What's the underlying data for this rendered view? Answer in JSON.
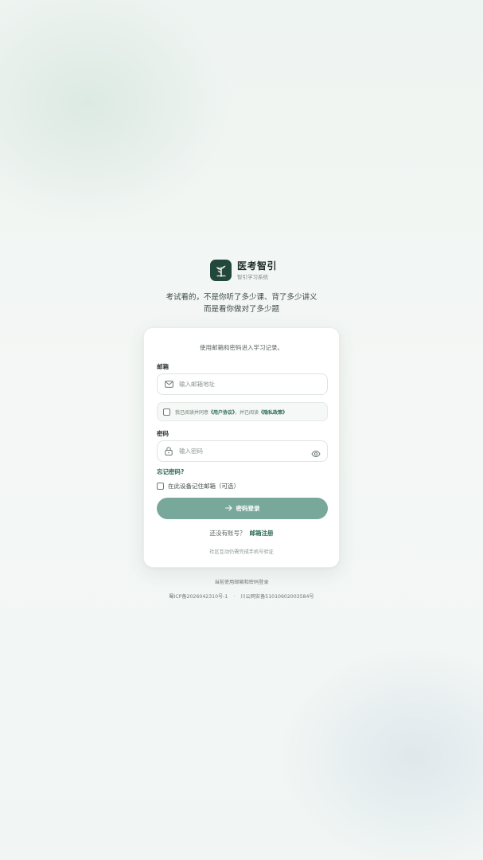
{
  "brand": {
    "name": "医考智引",
    "subtitle": "智引学习系统",
    "logo_icon": "plant-sprout-icon"
  },
  "tagline": {
    "line1": "考试看的，不是你听了多少课、背了多少讲义",
    "line2": "而是看你做对了多少题"
  },
  "card": {
    "intro": "使用邮箱和密码进入学习记录。",
    "email": {
      "label": "邮箱",
      "placeholder": "输入邮箱地址",
      "value": "",
      "icon": "mail-icon"
    },
    "agreement": {
      "checked": false,
      "prefix": "我已阅读并同意",
      "user_agreement": "《用户协议》",
      "middle": "，并已阅读",
      "privacy_policy": "《隐私政策》"
    },
    "password": {
      "label": "密码",
      "placeholder": "输入密码",
      "value": "",
      "icon": "lock-icon",
      "toggle_icon": "eye-icon"
    },
    "forgot_password": "忘记密码?",
    "remember": {
      "checked": false,
      "label": "在此设备记住邮箱（可选）"
    },
    "login_button": {
      "label": "密码登录",
      "icon": "arrow-right-icon"
    },
    "register": {
      "prompt": "还没有账号？",
      "link": "邮箱注册"
    },
    "community_note": "社区互动仍需完成手机号验证"
  },
  "footer": {
    "note": "当前使用邮箱和密码登录",
    "icp": "蜀ICP备2026042310号-1",
    "separator": "·",
    "police": "川公网安备51010602003584号"
  },
  "colors": {
    "brand_dark": "#22473d",
    "accent": "#2f6b57",
    "button": "#77a89a"
  }
}
